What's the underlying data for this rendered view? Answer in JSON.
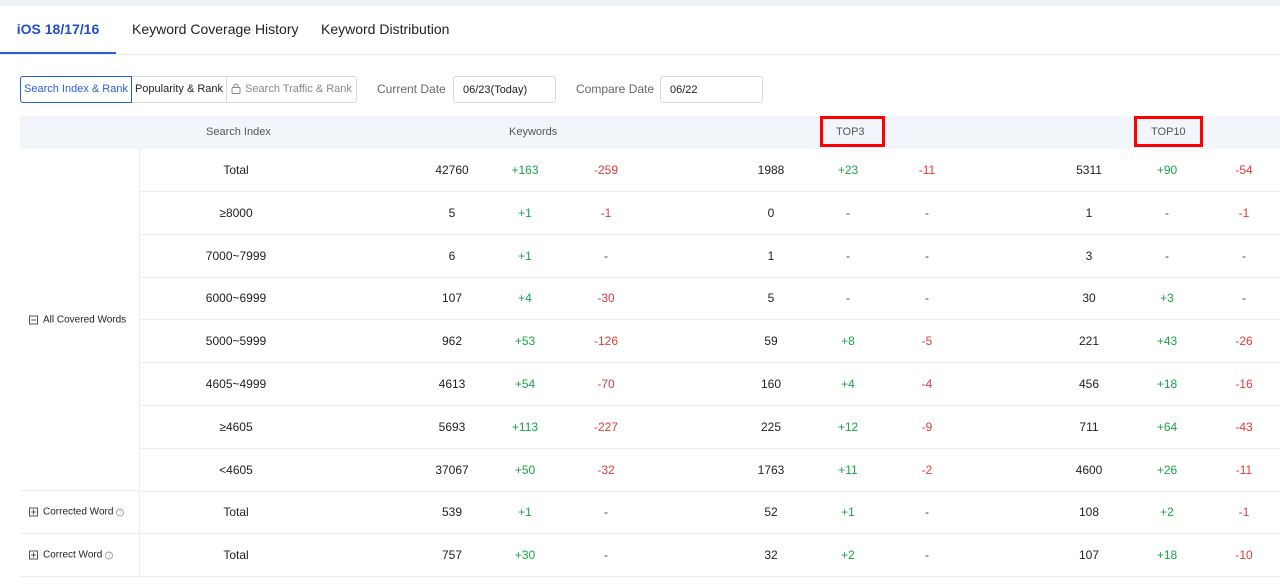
{
  "tabs": [
    {
      "label": "iOS 18/17/16",
      "active": true
    },
    {
      "label": "Keyword Coverage History",
      "active": false
    },
    {
      "label": "Keyword Distribution",
      "active": false
    }
  ],
  "toolbar": {
    "segments": [
      "Search Index & Rank",
      "Popularity & Rank",
      "Search Traffic & Rank"
    ],
    "current_date_label": "Current Date",
    "current_date_value": "06/23(Today)",
    "compare_date_label": "Compare Date",
    "compare_date_value": "06/22"
  },
  "table": {
    "headers": {
      "search_index": "Search Index",
      "keywords": "Keywords",
      "top3": "TOP3",
      "top10": "TOP10"
    },
    "groups": [
      {
        "label": "All Covered Words",
        "expanded": true,
        "help": false
      },
      {
        "label": "Corrected Word",
        "expanded": false,
        "help": true
      },
      {
        "label": "Correct Word",
        "expanded": false,
        "help": true
      }
    ],
    "rows": [
      {
        "label": "Total",
        "kw": "42760",
        "kw_up": "+163",
        "kw_dn": "-259",
        "t3": "1988",
        "t3_up": "+23",
        "t3_dn": "-11",
        "t10": "5311",
        "t10_up": "+90",
        "t10_dn": "-54"
      },
      {
        "label": "≥8000",
        "kw": "5",
        "kw_up": "+1",
        "kw_dn": "-1",
        "t3": "0",
        "t3_up": "-",
        "t3_dn": "-",
        "t10": "1",
        "t10_up": "-",
        "t10_dn": "-1"
      },
      {
        "label": "7000~7999",
        "kw": "6",
        "kw_up": "+1",
        "kw_dn": "-",
        "t3": "1",
        "t3_up": "-",
        "t3_dn": "-",
        "t10": "3",
        "t10_up": "-",
        "t10_dn": "-"
      },
      {
        "label": "6000~6999",
        "kw": "107",
        "kw_up": "+4",
        "kw_dn": "-30",
        "t3": "5",
        "t3_up": "-",
        "t3_dn": "-",
        "t10": "30",
        "t10_up": "+3",
        "t10_dn": "-"
      },
      {
        "label": "5000~5999",
        "kw": "962",
        "kw_up": "+53",
        "kw_dn": "-126",
        "t3": "59",
        "t3_up": "+8",
        "t3_dn": "-5",
        "t10": "221",
        "t10_up": "+43",
        "t10_dn": "-26"
      },
      {
        "label": "4605~4999",
        "kw": "4613",
        "kw_up": "+54",
        "kw_dn": "-70",
        "t3": "160",
        "t3_up": "+4",
        "t3_dn": "-4",
        "t10": "456",
        "t10_up": "+18",
        "t10_dn": "-16"
      },
      {
        "label": "≥4605",
        "kw": "5693",
        "kw_up": "+113",
        "kw_dn": "-227",
        "t3": "225",
        "t3_up": "+12",
        "t3_dn": "-9",
        "t10": "711",
        "t10_up": "+64",
        "t10_dn": "-43"
      },
      {
        "label": "<4605",
        "kw": "37067",
        "kw_up": "+50",
        "kw_dn": "-32",
        "t3": "1763",
        "t3_up": "+11",
        "t3_dn": "-2",
        "t10": "4600",
        "t10_up": "+26",
        "t10_dn": "-11"
      },
      {
        "label": "Total",
        "kw": "539",
        "kw_up": "+1",
        "kw_dn": "-",
        "t3": "52",
        "t3_up": "+1",
        "t3_dn": "-",
        "t10": "108",
        "t10_up": "+2",
        "t10_dn": "-1"
      },
      {
        "label": "Total",
        "kw": "757",
        "kw_up": "+30",
        "kw_dn": "-",
        "t3": "32",
        "t3_up": "+2",
        "t3_dn": "-",
        "t10": "107",
        "t10_up": "+18",
        "t10_dn": "-10"
      }
    ]
  },
  "colors": {
    "accent": "#2b5fd9",
    "positive": "#1aa34a",
    "negative": "#e03b3b",
    "highlight": "#ff0000"
  }
}
